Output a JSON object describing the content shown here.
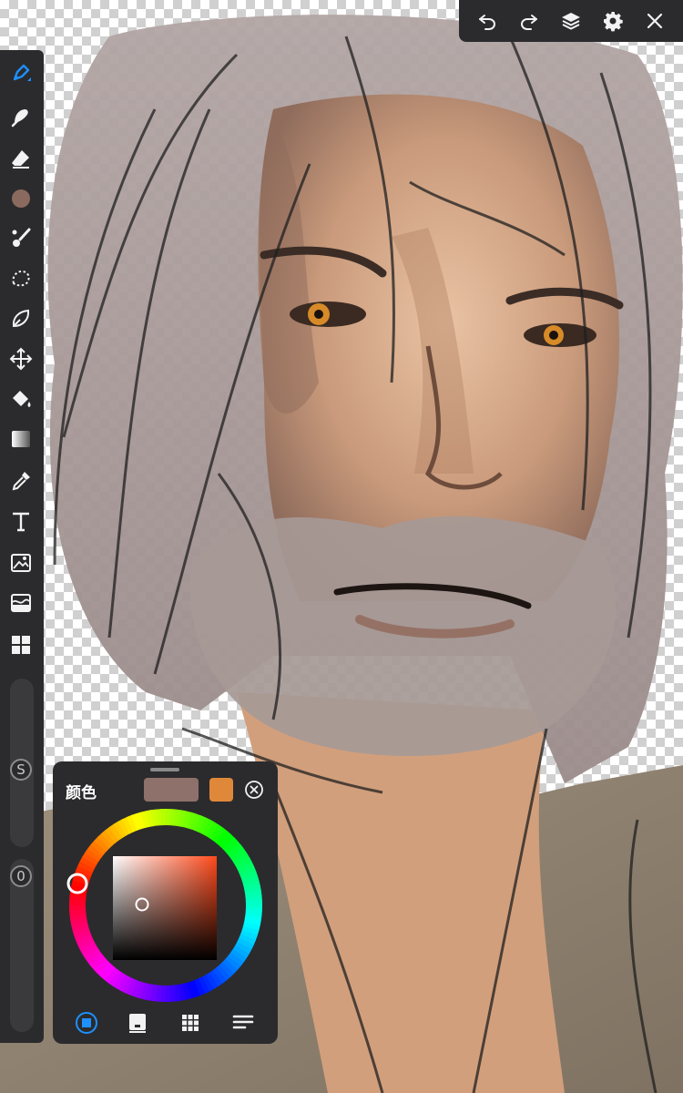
{
  "app": {
    "colors": {
      "panel_bg": "#2b2b2d",
      "accent": "#1e90ff",
      "icon": "#f2f2f2"
    }
  },
  "topbar": {
    "buttons": [
      {
        "name": "undo-icon"
      },
      {
        "name": "redo-icon"
      },
      {
        "name": "layers-icon"
      },
      {
        "name": "gear-icon"
      },
      {
        "name": "close-icon"
      }
    ]
  },
  "toolbar": {
    "active_tool": "brush",
    "tools": [
      "brush",
      "smudge",
      "eraser",
      "current-color",
      "brush-settings",
      "lasso-selection",
      "freeform-selection",
      "transform",
      "fill",
      "gradient",
      "eyedropper",
      "text",
      "image-import",
      "filter",
      "reference"
    ],
    "current_color": "#8a6a5f",
    "size_slider_label": "S",
    "opacity_slider_label": "0"
  },
  "color_panel": {
    "title": "颜色",
    "primary_color": "#8e716a",
    "secondary_color": "#e0883a",
    "tabs": [
      "wheel-tab",
      "classic-tab",
      "swatches-tab",
      "palette-list-tab"
    ],
    "active_tab": "wheel-tab"
  }
}
